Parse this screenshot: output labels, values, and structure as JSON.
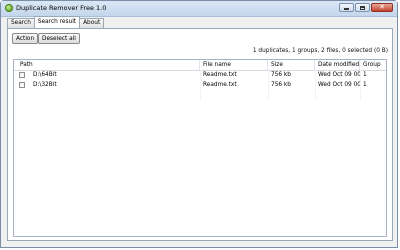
{
  "window": {
    "title": "Duplicate Remover Free 1.0"
  },
  "tabs": [
    {
      "label": "Search"
    },
    {
      "label": "Search result"
    },
    {
      "label": "About"
    }
  ],
  "toolbar": {
    "action_label": "Action",
    "deselect_label": "Deselect all"
  },
  "summary": "1 duplicates, 1 groups, 2 files, 0 selected (0 B)",
  "table": {
    "columns": [
      "Path",
      "File name",
      "Size",
      "Date modified",
      "Group"
    ],
    "rows": [
      {
        "checked": false,
        "path": "D:\\64Bit",
        "file_name": "Readme.txt",
        "size": "756 kb",
        "date_modified": "Wed Oct 09 00:...",
        "group": "1"
      },
      {
        "checked": false,
        "path": "D:\\32Bit",
        "file_name": "Readme.txt",
        "size": "756 kb",
        "date_modified": "Wed Oct 09 00:...",
        "group": "1"
      }
    ]
  }
}
